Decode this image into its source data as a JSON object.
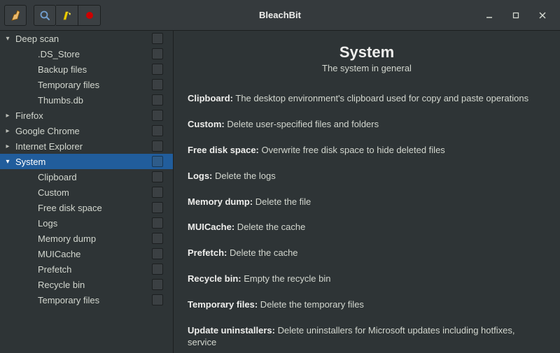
{
  "app": {
    "title": "BleachBit"
  },
  "toolbar": {
    "icons": [
      "broom-icon",
      "search-icon",
      "bell-icon",
      "record-icon"
    ]
  },
  "sidebar": {
    "items": [
      {
        "label": "Deep scan",
        "level": 0,
        "expanded": true,
        "check": true,
        "selected": false
      },
      {
        "label": ".DS_Store",
        "level": 1,
        "check": true,
        "selected": false
      },
      {
        "label": "Backup files",
        "level": 1,
        "check": true,
        "selected": false
      },
      {
        "label": "Temporary files",
        "level": 1,
        "check": true,
        "selected": false
      },
      {
        "label": "Thumbs.db",
        "level": 1,
        "check": true,
        "selected": false
      },
      {
        "label": "Firefox",
        "level": 0,
        "expanded": false,
        "check": true,
        "selected": false
      },
      {
        "label": "Google Chrome",
        "level": 0,
        "expanded": false,
        "check": true,
        "selected": false
      },
      {
        "label": "Internet Explorer",
        "level": 0,
        "expanded": false,
        "check": true,
        "selected": false
      },
      {
        "label": "System",
        "level": 0,
        "expanded": true,
        "check": true,
        "selected": true
      },
      {
        "label": "Clipboard",
        "level": 1,
        "check": true,
        "selected": false
      },
      {
        "label": "Custom",
        "level": 1,
        "check": true,
        "selected": false
      },
      {
        "label": "Free disk space",
        "level": 1,
        "check": true,
        "selected": false
      },
      {
        "label": "Logs",
        "level": 1,
        "check": true,
        "selected": false
      },
      {
        "label": "Memory dump",
        "level": 1,
        "check": true,
        "selected": false
      },
      {
        "label": "MUICache",
        "level": 1,
        "check": true,
        "selected": false
      },
      {
        "label": "Prefetch",
        "level": 1,
        "check": true,
        "selected": false
      },
      {
        "label": "Recycle bin",
        "level": 1,
        "check": true,
        "selected": false
      },
      {
        "label": "Temporary files",
        "level": 1,
        "check": true,
        "selected": false
      }
    ]
  },
  "detail": {
    "title": "System",
    "subtitle": "The system in general",
    "items": [
      {
        "name": "Clipboard:",
        "desc": "The desktop environment's clipboard used for copy and paste operations"
      },
      {
        "name": "Custom:",
        "desc": "Delete user-specified files and folders"
      },
      {
        "name": "Free disk space:",
        "desc": "Overwrite free disk space to hide deleted files"
      },
      {
        "name": "Logs:",
        "desc": "Delete the logs"
      },
      {
        "name": "Memory dump:",
        "desc": "Delete the file"
      },
      {
        "name": "MUICache:",
        "desc": "Delete the cache"
      },
      {
        "name": "Prefetch:",
        "desc": "Delete the cache"
      },
      {
        "name": "Recycle bin:",
        "desc": "Empty the recycle bin"
      },
      {
        "name": "Temporary files:",
        "desc": "Delete the temporary files"
      },
      {
        "name": "Update uninstallers:",
        "desc": "Delete uninstallers for Microsoft updates including hotfixes, service"
      }
    ]
  }
}
